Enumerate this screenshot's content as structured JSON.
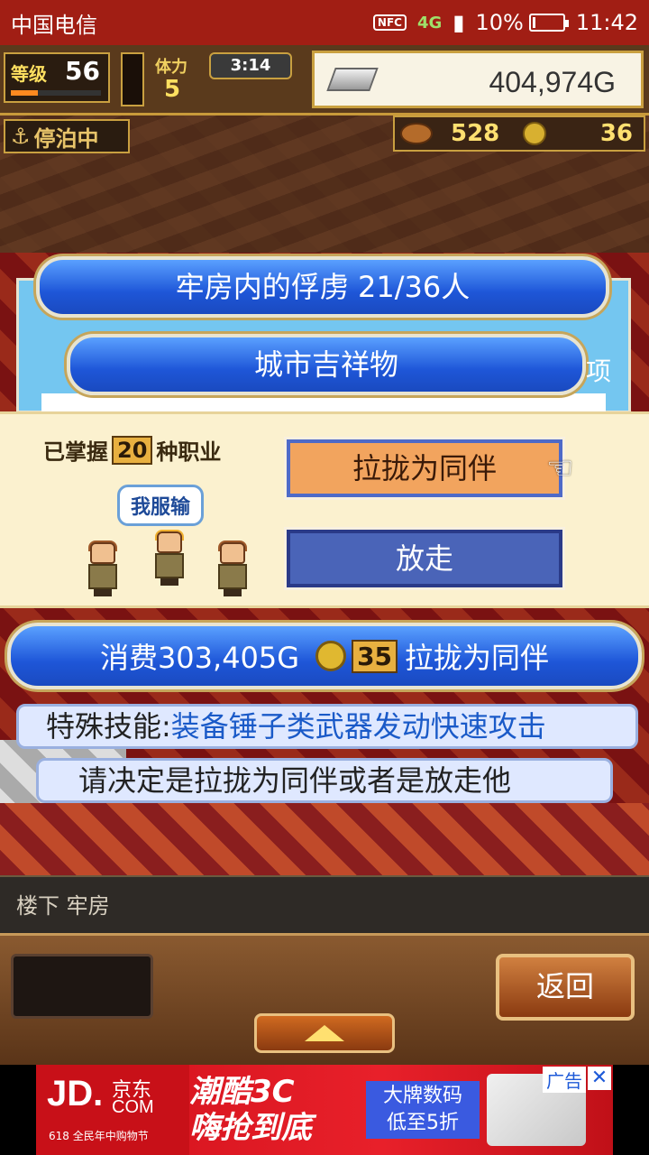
{
  "status_bar": {
    "carrier": "中国电信",
    "nfc": "NFC",
    "network": "4G",
    "battery_percent": "10%",
    "battery_level": 0.1,
    "time": "11:42"
  },
  "hud": {
    "level_label": "等级",
    "level_value": "56",
    "stamina_label": "体力",
    "stamina_value": "5",
    "timer": "3:14",
    "money": "404,974G",
    "docked_status": "停泊中",
    "food": "528",
    "coins": "36"
  },
  "prison_panel": {
    "title": "牢房内的俘虏  21/36人",
    "mascot_title": "城市吉祥物",
    "edge_text": "项"
  },
  "decision": {
    "jobs_prefix": "已掌握",
    "jobs_count": "20",
    "jobs_suffix": "种职业",
    "speech": "我服输",
    "recruit_label": "拉拢为同伴",
    "release_label": "放走"
  },
  "cost_bar": {
    "cost_text": "消费303,405G",
    "coin_count": "35",
    "action_text": "拉拢为同伴"
  },
  "info": {
    "skill_label": "特殊技能:",
    "skill_value": "装备锤子类武器发动快速攻击",
    "prompt": "请决定是拉拢为同伴或者是放走他"
  },
  "location": "楼下 牢房",
  "bottom": {
    "back_label": "返回"
  },
  "ad": {
    "logo_jd": "JD.",
    "logo_cn": "京东",
    "logo_com": "COM",
    "logo_sub": "618 全民年中购物节",
    "slogan_1": "潮酷3C",
    "slogan_2": "嗨抢到底",
    "badge_1": "大牌数码",
    "badge_2": "低至5折",
    "tag": "广告",
    "close": "✕"
  },
  "colors": {
    "status_bar": "#a11e14",
    "panel_blue": "#1e56d8",
    "recruit_button": "#f2a45e",
    "release_button": "#4a64b8",
    "skill_text": "#1a5ac8"
  }
}
